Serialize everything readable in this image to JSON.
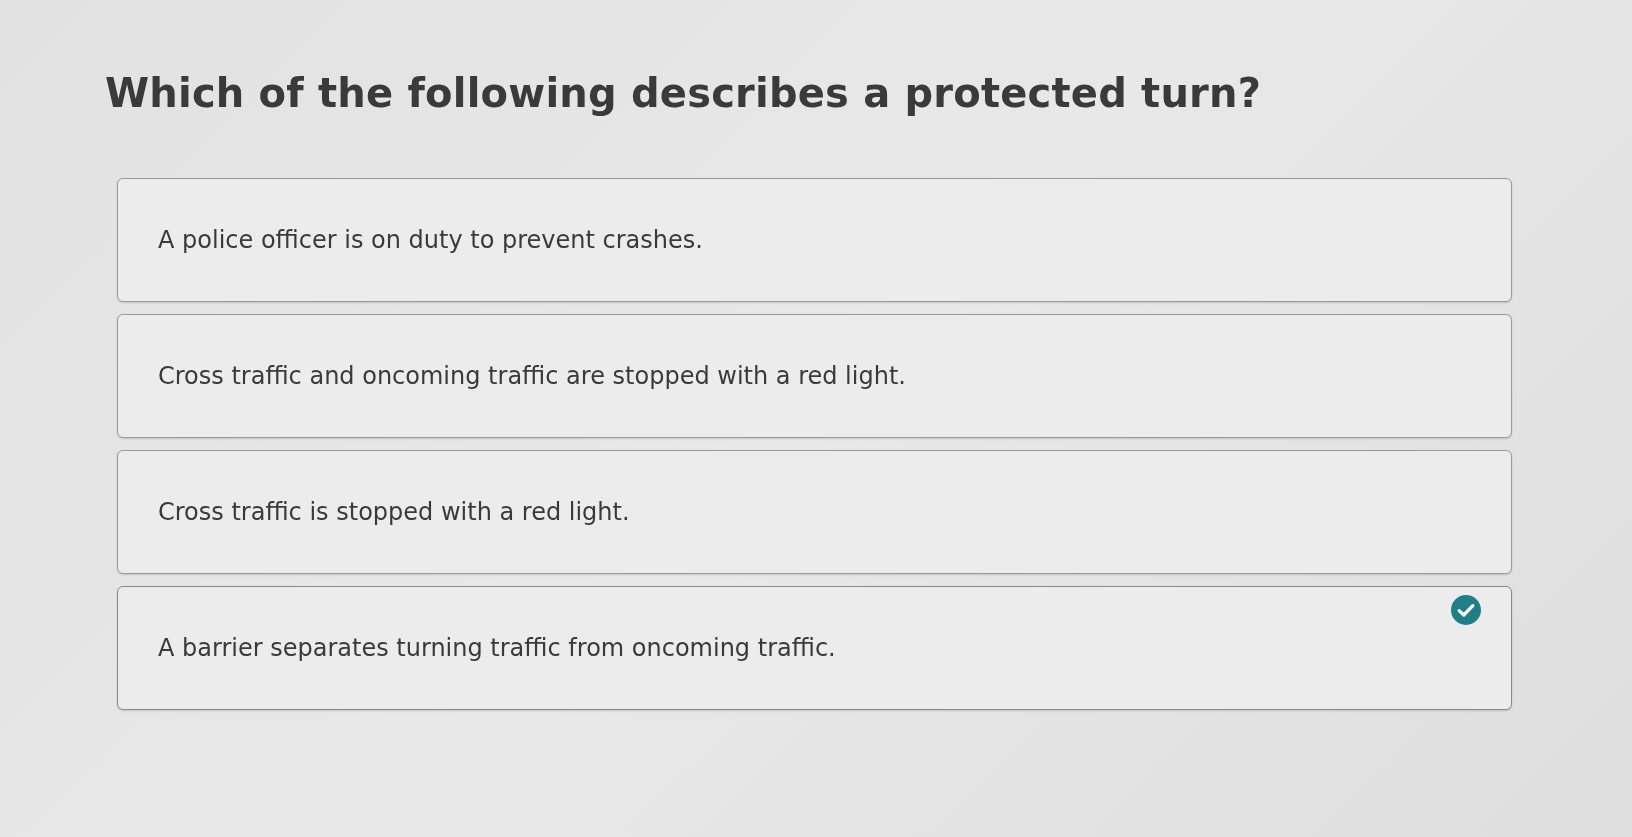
{
  "question": "Which of the following describes a protected turn?",
  "options": [
    {
      "text": "A police officer is on duty to prevent crashes.",
      "selected": false
    },
    {
      "text": "Cross traffic and oncoming traffic are stopped with a red light.",
      "selected": false
    },
    {
      "text": "Cross traffic is stopped with a red light.",
      "selected": false
    },
    {
      "text": "A barrier separates turning traffic from oncoming traffic.",
      "selected": true
    }
  ]
}
